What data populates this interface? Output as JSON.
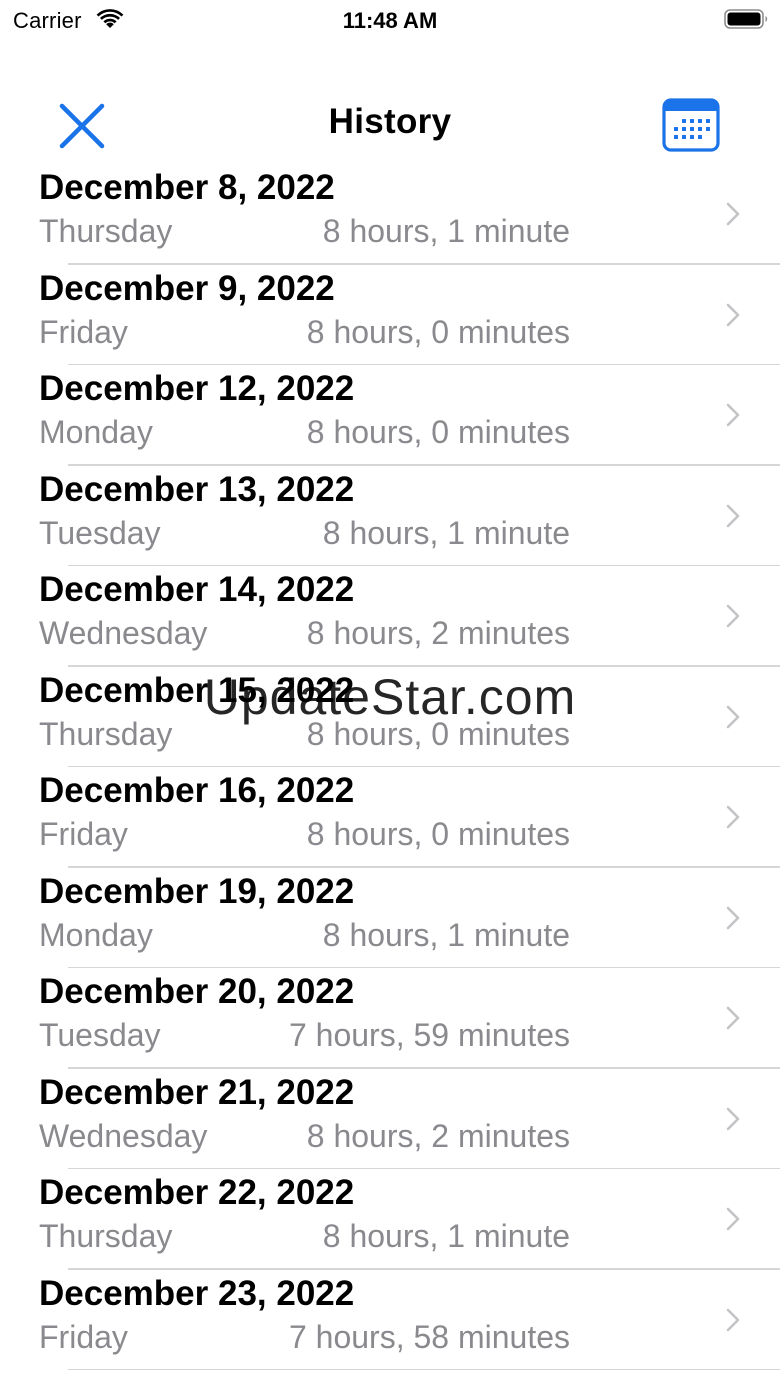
{
  "status_bar": {
    "carrier": "Carrier",
    "time": "11:48 AM"
  },
  "nav": {
    "title": "History",
    "close_icon": "close-x-icon",
    "calendar_icon": "calendar-icon",
    "accent_color": "#1a73e8"
  },
  "rows": [
    {
      "date": "December 8, 2022",
      "day": "Thursday",
      "duration": "8 hours, 1 minute"
    },
    {
      "date": "December 9, 2022",
      "day": "Friday",
      "duration": "8 hours, 0 minutes"
    },
    {
      "date": "December 12, 2022",
      "day": "Monday",
      "duration": "8 hours, 0 minutes"
    },
    {
      "date": "December 13, 2022",
      "day": "Tuesday",
      "duration": "8 hours, 1 minute"
    },
    {
      "date": "December 14, 2022",
      "day": "Wednesday",
      "duration": "8 hours, 2 minutes"
    },
    {
      "date": "December 15, 2022",
      "day": "Thursday",
      "duration": "8 hours, 0 minutes"
    },
    {
      "date": "December 16, 2022",
      "day": "Friday",
      "duration": "8 hours, 0 minutes"
    },
    {
      "date": "December 19, 2022",
      "day": "Monday",
      "duration": "8 hours, 1 minute"
    },
    {
      "date": "December 20, 2022",
      "day": "Tuesday",
      "duration": "7 hours, 59 minutes"
    },
    {
      "date": "December 21, 2022",
      "day": "Wednesday",
      "duration": "8 hours, 2 minutes"
    },
    {
      "date": "December 22, 2022",
      "day": "Thursday",
      "duration": "8 hours, 1 minute"
    },
    {
      "date": "December 23, 2022",
      "day": "Friday",
      "duration": "7 hours, 58 minutes"
    }
  ],
  "watermark": "UpdateStar.com"
}
